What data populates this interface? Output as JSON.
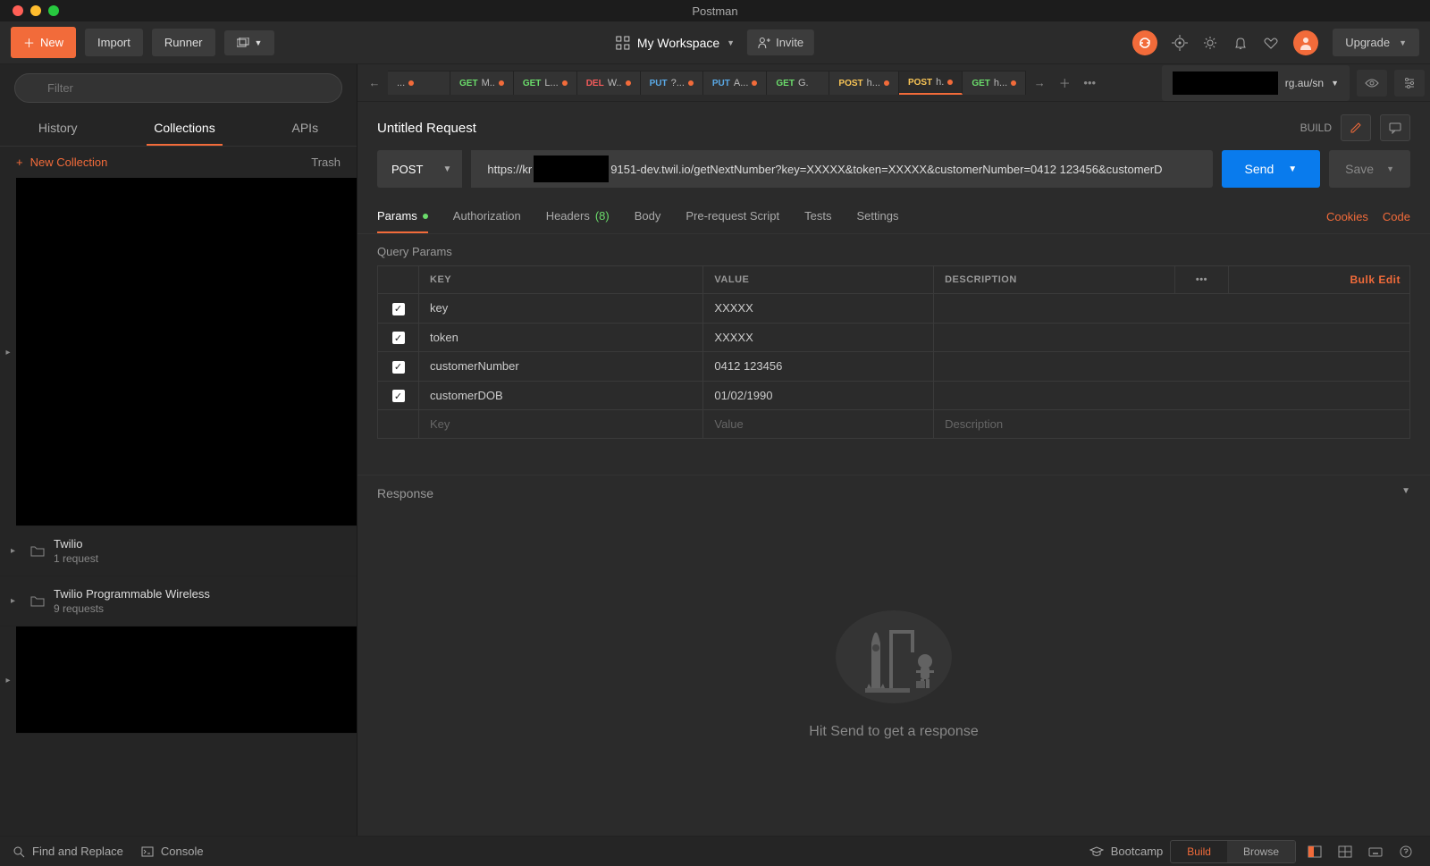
{
  "window": {
    "title": "Postman"
  },
  "toolbar": {
    "new": "New",
    "import": "Import",
    "runner": "Runner",
    "workspace": "My Workspace",
    "invite": "Invite",
    "upgrade": "Upgrade"
  },
  "sidebar": {
    "filter_placeholder": "Filter",
    "tabs": {
      "history": "History",
      "collections": "Collections",
      "apis": "APIs"
    },
    "new_collection": "New Collection",
    "trash": "Trash",
    "collections": {
      "twilio": {
        "name": "Twilio",
        "sub": "1 request"
      },
      "wireless": {
        "name": "Twilio Programmable Wireless",
        "sub": "9 requests"
      }
    }
  },
  "tabs": [
    {
      "method": "",
      "label": "..."
    },
    {
      "method": "GET",
      "label": "M.."
    },
    {
      "method": "GET",
      "label": "L..."
    },
    {
      "method": "DEL",
      "label": "W.."
    },
    {
      "method": "PUT",
      "label": "?..."
    },
    {
      "method": "PUT",
      "label": "A..."
    },
    {
      "method": "GET",
      "label": "G."
    },
    {
      "method": "POST",
      "label": "h..."
    },
    {
      "method": "POST",
      "label": "h."
    },
    {
      "method": "GET",
      "label": "h..."
    }
  ],
  "env": {
    "name": "rg.au/sn"
  },
  "request": {
    "name": "Untitled Request",
    "build": "BUILD",
    "method": "POST",
    "url_pre": "https://kr",
    "url_post": "9151-dev.twil.io/getNextNumber?key=XXXXX&token=XXXXX&customerNumber=0412 123456&customerD",
    "send": "Send",
    "save": "Save"
  },
  "reqtabs": {
    "params": "Params",
    "auth": "Authorization",
    "headers": "Headers",
    "headers_count": "(8)",
    "body": "Body",
    "prereq": "Pre-request Script",
    "tests": "Tests",
    "settings": "Settings",
    "cookies": "Cookies",
    "code": "Code"
  },
  "params": {
    "section": "Query Params",
    "head": {
      "key": "KEY",
      "value": "VALUE",
      "desc": "DESCRIPTION",
      "bulk": "Bulk Edit"
    },
    "rows": [
      {
        "key": "key",
        "value": "XXXXX"
      },
      {
        "key": "token",
        "value": "XXXXX"
      },
      {
        "key": "customerNumber",
        "value": "0412 123456"
      },
      {
        "key": "customerDOB",
        "value": "01/02/1990"
      }
    ],
    "placeholder": {
      "key": "Key",
      "value": "Value",
      "desc": "Description"
    }
  },
  "response": {
    "title": "Response",
    "hint": "Hit Send to get a response"
  },
  "statusbar": {
    "find": "Find and Replace",
    "console": "Console",
    "bootcamp": "Bootcamp",
    "build": "Build",
    "browse": "Browse"
  }
}
